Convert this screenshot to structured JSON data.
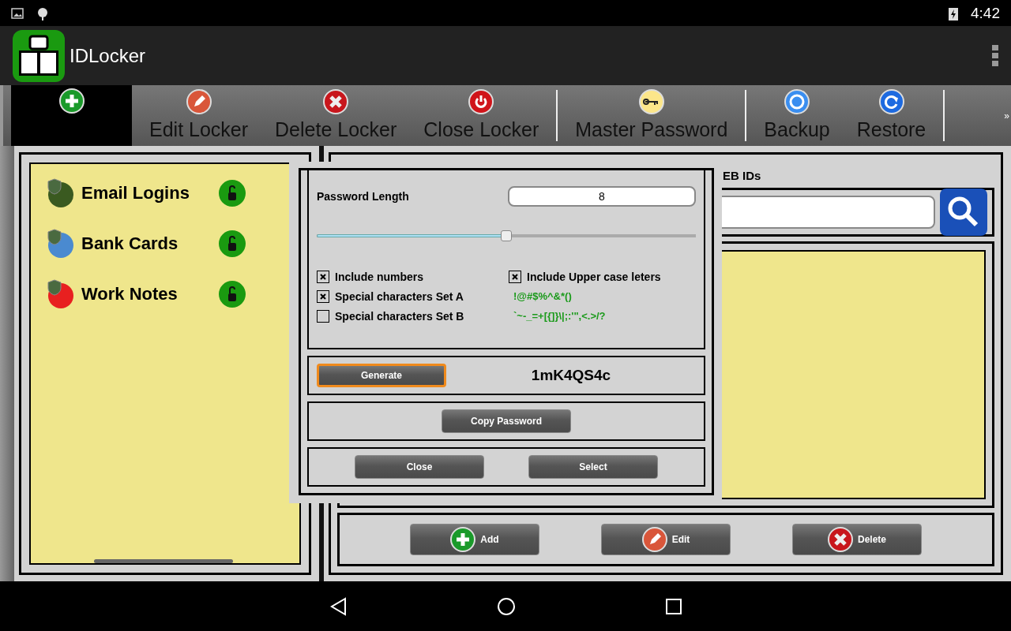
{
  "status_bar": {
    "time": "4:42"
  },
  "app_bar": {
    "title": "IDLocker"
  },
  "toolbar": {
    "add_tile": {
      "selected": true
    },
    "groups": [
      [
        {
          "label": "Edit Locker"
        },
        {
          "label": "Delete Locker"
        },
        {
          "label": "Close Locker"
        }
      ],
      [
        {
          "label": "Master Password"
        }
      ],
      [
        {
          "label": "Backup"
        },
        {
          "label": "Restore"
        }
      ]
    ],
    "more": "»"
  },
  "lockers": [
    {
      "name": "Email Logins"
    },
    {
      "name": "Bank Cards"
    },
    {
      "name": "Work Notes"
    }
  ],
  "right_panel": {
    "header": "EB IDs",
    "buttons": [
      {
        "label": "Add"
      },
      {
        "label": "Edit"
      },
      {
        "label": "Delete"
      }
    ]
  },
  "dialog": {
    "length_label": "Password Length",
    "length_value": "8",
    "slider": {
      "level": 0.5
    },
    "left_options": [
      {
        "label": "Include numbers",
        "checked": true
      },
      {
        "label": "Special characters Set A",
        "checked": true
      },
      {
        "label": "Special characters Set B",
        "checked": false
      }
    ],
    "right_options": [
      {
        "kind": "checkbox",
        "label": "Include Upper case leters",
        "checked": true
      },
      {
        "kind": "sample",
        "label": "!@#$%^&*()"
      },
      {
        "kind": "sample",
        "label": "`~-_=+[{]}\\|;:'\",<.>/?"
      }
    ],
    "generate": {
      "label": "Generate",
      "focused": true
    },
    "password": "1mK4QS4c",
    "copy": "Copy Password",
    "close": "Close",
    "select": "Select"
  }
}
